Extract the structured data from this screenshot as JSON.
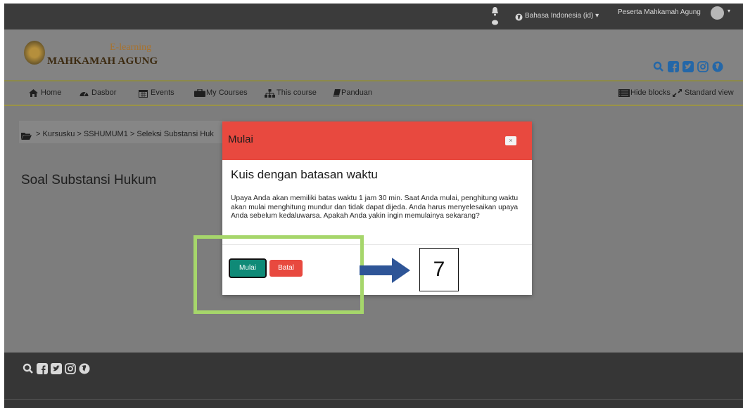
{
  "colors": {
    "accent": "#e8493f",
    "primary_button": "#0f8a77",
    "highlight_box": "#a6d66b",
    "arrow": "#2e5597"
  },
  "topbar": {
    "language": "Bahasa Indonesia (id)",
    "user_name": "Peserta Mahkamah Agung"
  },
  "header": {
    "logo_small": "E-learning",
    "logo_main": "MAHKAMAH AGUNG",
    "social_icons": [
      "search-icon",
      "facebook-icon",
      "twitter-icon",
      "instagram-icon",
      "globe-icon"
    ]
  },
  "nav": {
    "items": [
      {
        "label": "Home",
        "icon": "home-icon"
      },
      {
        "label": "Dasbor",
        "icon": "dashboard-icon"
      },
      {
        "label": "Events",
        "icon": "calendar-icon"
      },
      {
        "label": "My Courses",
        "icon": "briefcase-icon"
      },
      {
        "label": "This course",
        "icon": "sitemap-icon"
      },
      {
        "label": "Panduan",
        "icon": "book-icon"
      }
    ],
    "hide_blocks": "Hide blocks",
    "standard_view": "Standard view"
  },
  "breadcrumb": {
    "text": "> Kursusku > SSHUMUM1 > Seleksi Substansi Huk"
  },
  "page": {
    "title": "Soal Substansi Hukum"
  },
  "modal": {
    "title": "Mulai",
    "close_label": "×",
    "subtitle": "Kuis dengan batasan waktu",
    "body": "Upaya Anda akan memiliki batas waktu 1 jam 30 min. Saat Anda mulai, penghitung waktu akan mulai menghitung mundur dan tidak dapat dijeda. Anda harus menyelesaikan upaya Anda sebelum kedaluwarsa. Apakah Anda yakin ingin memulainya sekarang?",
    "start_label": "Mulai",
    "cancel_label": "Batal"
  },
  "annotation": {
    "step_number": "7"
  }
}
